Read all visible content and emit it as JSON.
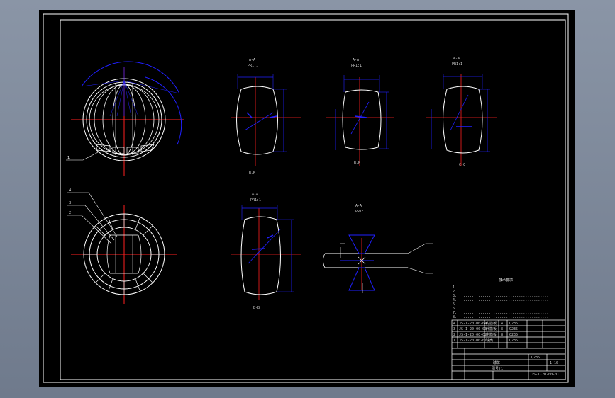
{
  "views": {
    "view1": {
      "top": "A-A",
      "dim": "PR1:1",
      "bottom": "B-B"
    },
    "view2": {
      "top": "A-A",
      "dim": "PR1:1",
      "bottom": "B-B"
    },
    "view3": {
      "top": "A-A",
      "dim": "PR1:1",
      "bottom": "C-C"
    },
    "view4": {
      "top": "A-A",
      "dim": "PR1:1",
      "bottom": "B-B"
    },
    "weld": {
      "top": "A-A",
      "dim": "PR1:1"
    }
  },
  "balloons": [
    "1",
    "2",
    "3",
    "4"
  ],
  "tech_notes": {
    "title": "技术要求",
    "lines": [
      "1. ..........................................",
      "2. ..........................................",
      "3. ..........................................",
      "4. ..........................................",
      "5. ..........................................",
      "6. ..........................................",
      "7. ..........................................",
      "8. .........................................."
    ]
  },
  "title_block": {
    "name": "球体",
    "sub": "图号(1)",
    "code": "JS-1-20-00-01",
    "scale": "1:10",
    "material": "Q235",
    "rows": [
      [
        "4",
        "JS-1-20-00-04",
        "内筋板",
        "4",
        "Q235",
        ""
      ],
      [
        "3",
        "JS-1-20-00-03",
        "外筋板",
        "8",
        "Q235",
        ""
      ],
      [
        "2",
        "JS-1-20-00-02",
        "中筋板",
        "8",
        "Q235",
        ""
      ],
      [
        "1",
        "JS-1-20-00-01",
        "球壳",
        "1",
        "Q235",
        ""
      ]
    ]
  }
}
